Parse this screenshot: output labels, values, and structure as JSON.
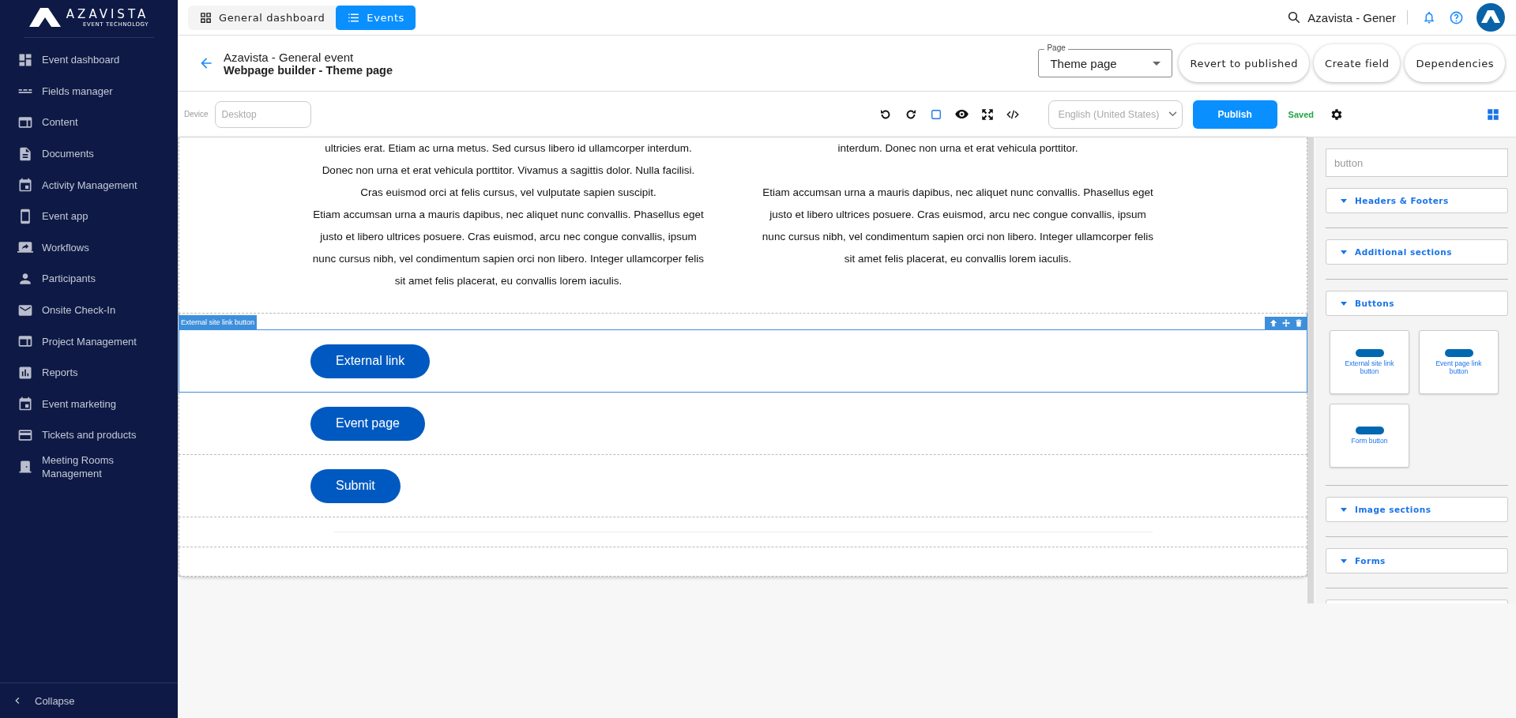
{
  "sidebar": {
    "logo": {
      "name": "AZAVISTA",
      "tagline": "EVENT TECHNOLOGY"
    },
    "items": [
      {
        "label": "Event dashboard"
      },
      {
        "label": "Fields manager"
      },
      {
        "label": "Content"
      },
      {
        "label": "Documents"
      },
      {
        "label": "Activity Management"
      },
      {
        "label": "Event app"
      },
      {
        "label": "Workflows"
      },
      {
        "label": "Participants"
      },
      {
        "label": "Onsite Check-In"
      },
      {
        "label": "Project Management"
      },
      {
        "label": "Reports"
      },
      {
        "label": "Event marketing"
      },
      {
        "label": "Tickets and products"
      },
      {
        "label": "Meeting Rooms Management"
      }
    ],
    "collapse": "Collapse"
  },
  "top_bar": {
    "tabs": [
      {
        "label": "General dashboard",
        "selected": false
      },
      {
        "label": "Events",
        "selected": true
      }
    ],
    "search_text": "Azavista - Gener"
  },
  "header": {
    "event": "Azavista - General event",
    "title": "Webpage builder - Theme page",
    "page_select": {
      "label": "Page",
      "value": "Theme page"
    },
    "buttons": [
      "Revert to published",
      "Create field",
      "Dependencies"
    ]
  },
  "toolbar": {
    "device_label": "Device",
    "device_placeholder": "Desktop",
    "language": "English (United States)",
    "publish": "Publish",
    "status": "Saved"
  },
  "canvas": {
    "sections": [
      {
        "kind": "text",
        "selected": false,
        "columns": [
          {
            "paragraphs": [
              [
                "ultricies erat. Etiam ac urna metus. Sed cursus libero id ullamcorper interdum.",
                "Donec non urna et erat vehicula porttitor. Vivamus a sagittis dolor. Nulla facilisi.",
                "Cras euismod orci at felis cursus, vel vulputate sapien suscipit."
              ],
              [
                "Etiam accumsan urna a mauris dapibus, nec aliquet nunc convallis. Phasellus eget",
                "justo et libero ultrices posuere. Cras euismod, arcu nec congue convallis, ipsum",
                "nunc cursus nibh, vel condimentum sapien orci non libero. Integer ullamcorper felis",
                "sit amet felis placerat, eu convallis lorem iaculis."
              ]
            ]
          },
          {
            "paragraphs": [
              [
                "interdum. Donec non urna et erat vehicula porttitor."
              ],
              [
                "Etiam accumsan urna a mauris dapibus, nec aliquet nunc convallis. Phasellus eget",
                "justo et libero ultrices posuere. Cras euismod, arcu nec congue convallis, ipsum",
                "nunc cursus nibh, vel condimentum sapien orci non libero. Integer ullamcorper felis",
                "sit amet felis placerat, eu convallis lorem iaculis."
              ]
            ]
          }
        ]
      },
      {
        "kind": "button",
        "selected": true,
        "tag": "External site link button",
        "label": "External link"
      },
      {
        "kind": "button",
        "selected": false,
        "label": "Event page"
      },
      {
        "kind": "button",
        "selected": false,
        "label": "Submit"
      },
      {
        "kind": "divider",
        "selected": false
      },
      {
        "kind": "empty",
        "selected": false
      }
    ]
  },
  "panel": {
    "search_value": "button",
    "groups": [
      {
        "title": "Headers & Footers"
      },
      {
        "title": "Additional sections"
      },
      {
        "title": "Buttons",
        "tiles": [
          "External site link button",
          "Event page link button",
          "Form button"
        ]
      },
      {
        "title": "Image sections"
      },
      {
        "title": "Forms"
      }
    ]
  }
}
